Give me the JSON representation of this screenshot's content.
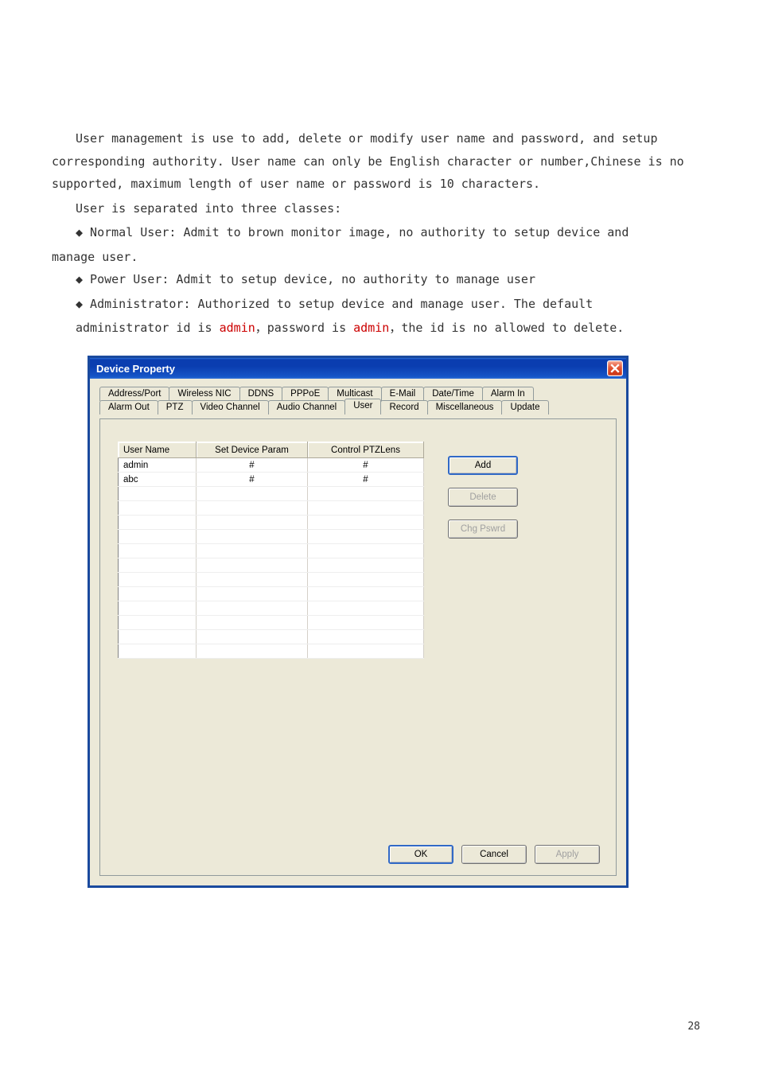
{
  "doc": {
    "p1": "User management is use to add, delete or modify user name and password, and setup corresponding authority. User name can only be English character or number,Chinese is no supported, maximum length of user name or password is 10 characters.",
    "p2": "User is separated into three classes:",
    "b1": "◆ Normal User: Admit to brown monitor image, no authority to setup device and",
    "b1cont": "manage user.",
    "b2": "◆ Power User: Admit to setup device, no authority to manage user",
    "b3a": "◆ Administrator: Authorized to setup device and manage user. The default",
    "b3b_pre": "administrator id is ",
    "b3b_admin1": "admin",
    "b3b_mid": "，password is ",
    "b3b_admin2": "admin",
    "b3b_post": "，the id is no allowed to delete."
  },
  "dialog": {
    "title": "Device Property",
    "tabs_row1": [
      "Address/Port",
      "Wireless NIC",
      "DDNS",
      "PPPoE",
      "Multicast",
      "E-Mail",
      "Date/Time",
      "Alarm In"
    ],
    "tabs_row2": [
      "Alarm Out",
      "PTZ",
      "Video Channel",
      "Audio Channel",
      "User",
      "Record",
      "Miscellaneous",
      "Update"
    ],
    "active_tab_index_row2": 4,
    "table": {
      "headers": [
        "User Name",
        "Set Device Param",
        "Control PTZLens"
      ],
      "rows": [
        {
          "name": "admin",
          "set": "#",
          "ctrl": "#"
        },
        {
          "name": "abc",
          "set": "#",
          "ctrl": "#"
        }
      ],
      "empty_rows": 12
    },
    "buttons": {
      "add": "Add",
      "delete": "Delete",
      "chg": "Chg Pswrd",
      "ok": "OK",
      "cancel": "Cancel",
      "apply": "Apply"
    }
  },
  "page_number": "28"
}
